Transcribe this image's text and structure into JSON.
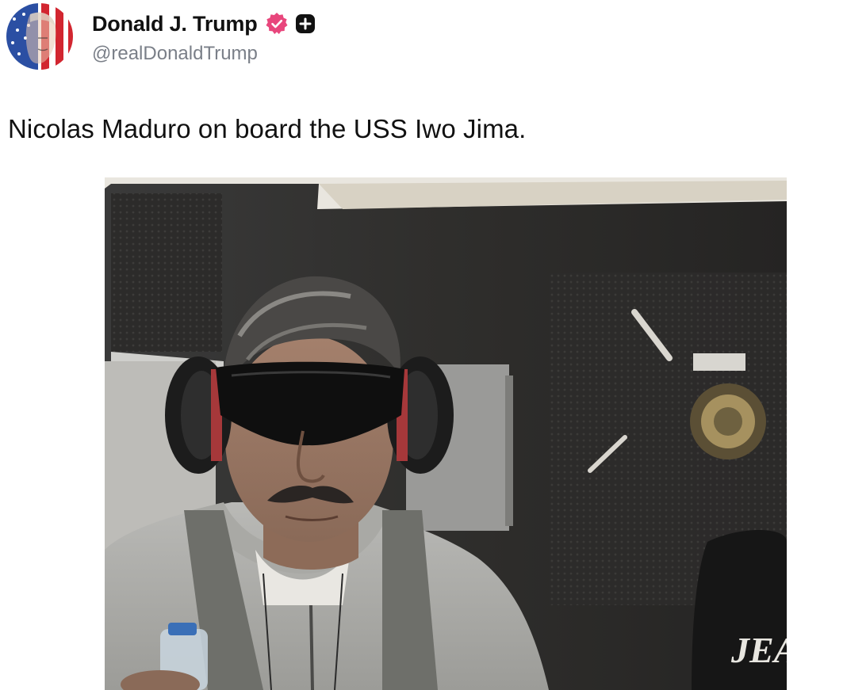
{
  "post": {
    "author": {
      "display_name": "Donald J. Trump",
      "handle": "@realDonaldTrump",
      "avatar": "avatar-flag-portrait",
      "verified_icon": "verified-badge-icon",
      "verified_color": "#e8467c",
      "plus_icon": "plus-square-icon"
    },
    "text": "Nicolas Maduro on board the USS Iwo Jima.",
    "media": {
      "kind": "photo",
      "description_icon": "photo-image",
      "sweatshirt_text": "JEA"
    }
  },
  "colors": {
    "text": "#111111",
    "handle": "#7a7f88",
    "background": "#ffffff"
  }
}
